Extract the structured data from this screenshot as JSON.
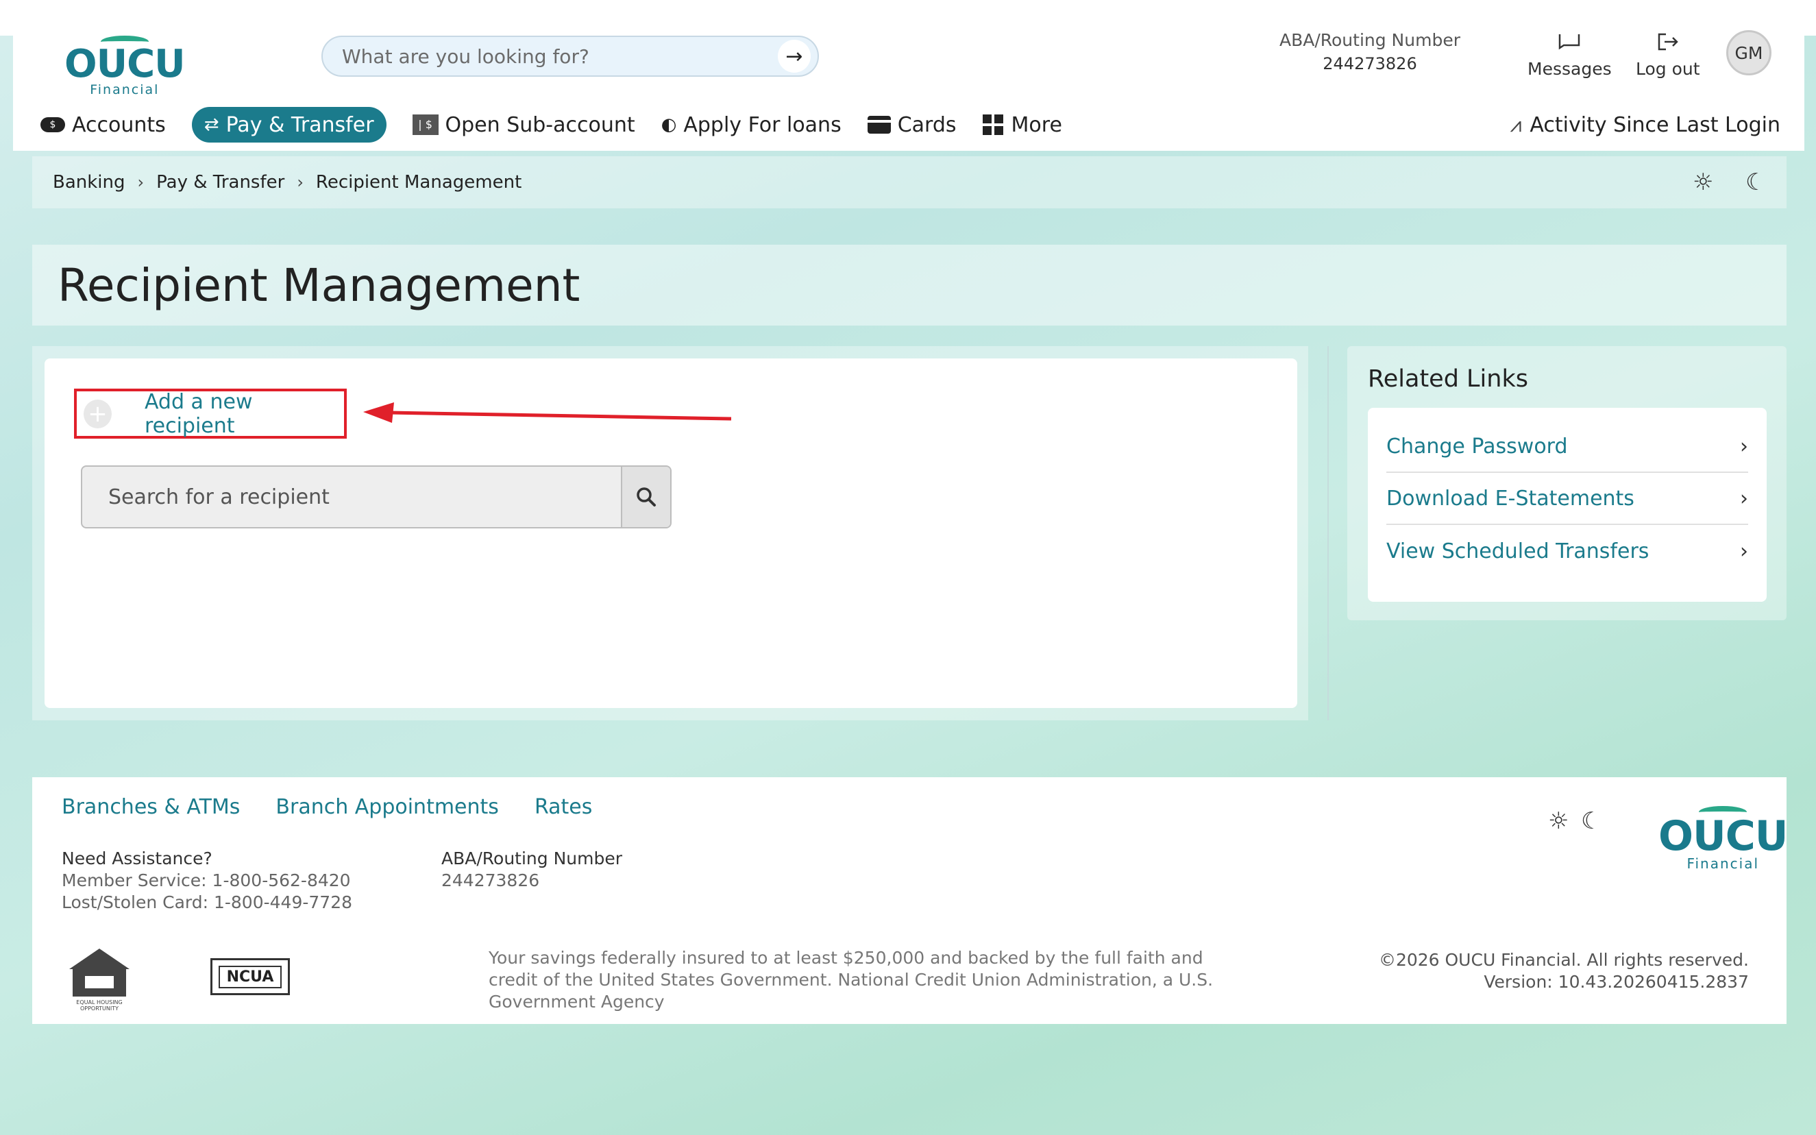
{
  "header": {
    "logo_mark": "OUCU",
    "logo_sub": "Financial",
    "search_placeholder": "What are you looking for?",
    "aba_label": "ABA/Routing Number",
    "aba_value": "244273826",
    "messages_label": "Messages",
    "logout_label": "Log out",
    "avatar_initials": "GM"
  },
  "nav": {
    "items": [
      {
        "label": "Accounts",
        "icon": "cash-pill-icon"
      },
      {
        "label": "Pay & Transfer",
        "icon": "transfer-arrows-icon",
        "active": true
      },
      {
        "label": "Open Sub-account",
        "icon": "sub-account-icon"
      },
      {
        "label": "Apply For loans",
        "icon": "loan-icon"
      },
      {
        "label": "Cards",
        "icon": "card-icon"
      },
      {
        "label": "More",
        "icon": "grid-icon"
      }
    ],
    "activity_label": "Activity Since Last Login"
  },
  "breadcrumb": [
    "Banking",
    "Pay & Transfer",
    "Recipient Management"
  ],
  "page_title": "Recipient Management",
  "main": {
    "add_recipient_label": "Add a new recipient",
    "search_placeholder": "Search for a recipient"
  },
  "related": {
    "title": "Related Links",
    "links": [
      "Change Password",
      "Download E-Statements",
      "View Scheduled Transfers"
    ]
  },
  "footer": {
    "links": [
      "Branches & ATMs",
      "Branch Appointments",
      "Rates"
    ],
    "assist_title": "Need Assistance?",
    "member_service": "Member Service: 1-800-562-8420",
    "lost_card": "Lost/Stolen Card: 1-800-449-7728",
    "aba_label": "ABA/Routing Number",
    "aba_value": "244273826",
    "ehl_text": "EQUAL HOUSING OPPORTUNITY",
    "ncua": "NCUA",
    "disclaimer": "Your savings federally insured to at least $250,000 and backed by the full faith and credit of the United States Government. National Credit Union Administration, a U.S. Government Agency",
    "copyright": "©2026 OUCU Financial. All rights reserved.",
    "version": "Version: 10.43.20260415.2837"
  },
  "colors": {
    "brand_teal": "#1b7b8c",
    "logo_green": "#2aa889",
    "annotation_red": "#e0202a"
  }
}
